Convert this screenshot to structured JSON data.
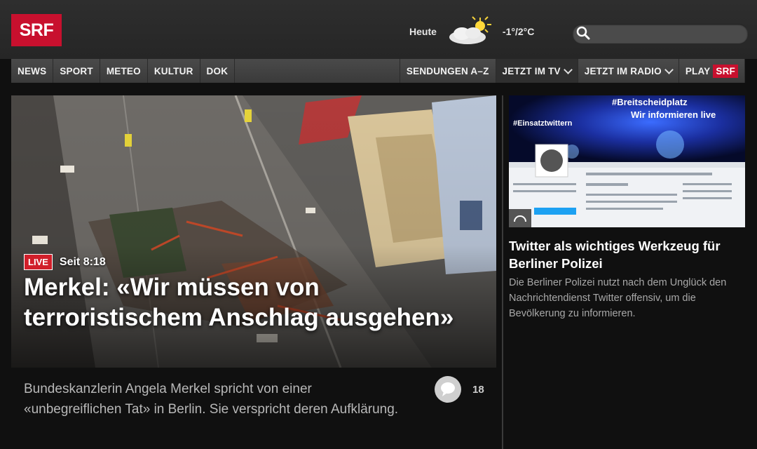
{
  "brand": {
    "logo": "SRF"
  },
  "weather": {
    "label": "Heute",
    "temperature": "-1°/2°C",
    "icon": "sun-cloud-icon"
  },
  "search": {
    "placeholder": ""
  },
  "nav": {
    "left": [
      "NEWS",
      "SPORT",
      "METEO",
      "KULTUR",
      "DOK"
    ],
    "sendungen": "SENDUNGEN A–Z",
    "tv": "JETZT IM TV",
    "radio": "JETZT IM RADIO",
    "play_label": "PLAY",
    "play_brand": "SRF"
  },
  "hero": {
    "badge": "LIVE",
    "since": "Seit 8:18",
    "headline": "Merkel: «Wir müssen von terroristischem Anschlag ausgehen»",
    "teaser": "Bundeskanzlerin Angela Merkel spricht von einer «unbegreiflichen Tat» in Berlin. Sie verspricht deren Aufklärung.",
    "comments": "18"
  },
  "side": {
    "hashtag1": "#Breitscheidplatz",
    "hashtag2": "Wir informieren live",
    "hashtag3": "#Einsatztwittern",
    "title": "Twitter als wichtiges Werkzeug für Berliner Polizei",
    "text": "Die Berliner Polizei nutzt nach dem Unglück den Nachrichtendienst Twitter offensiv, um die Bevölkerung zu informieren."
  },
  "colors": {
    "brand_red": "#c8102e",
    "live_red": "#d11f2a",
    "background": "#101010"
  }
}
